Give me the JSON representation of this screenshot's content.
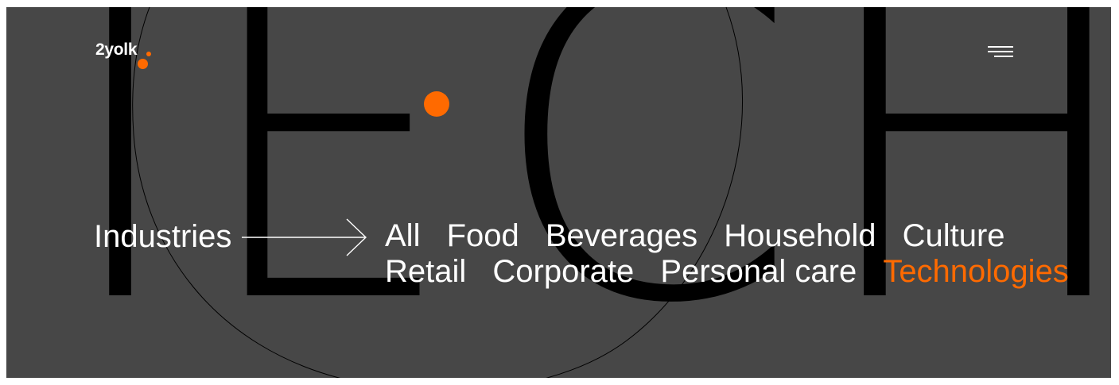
{
  "brand": {
    "logo_text": "2yolk",
    "accent_color": "#ff6a00",
    "background_color": "#474747"
  },
  "hero": {
    "background_word": "TECH",
    "letters": [
      "T",
      "E",
      "C",
      "H"
    ]
  },
  "header": {
    "menu_icon": "hamburger-menu-icon"
  },
  "filter": {
    "label": "Industries",
    "arrow_icon": "long-arrow-right-icon",
    "rows": [
      [
        "All",
        "Food",
        "Beverages",
        "Household",
        "Culture"
      ],
      [
        "Retail",
        "Corporate",
        "Personal care",
        "Technologies"
      ]
    ],
    "items": {
      "all": "All",
      "food": "Food",
      "beverages": "Beverages",
      "household": "Household",
      "culture": "Culture",
      "retail": "Retail",
      "corporate": "Corporate",
      "personal_care": "Personal care",
      "technologies": "Technologies"
    },
    "active": "Technologies"
  }
}
